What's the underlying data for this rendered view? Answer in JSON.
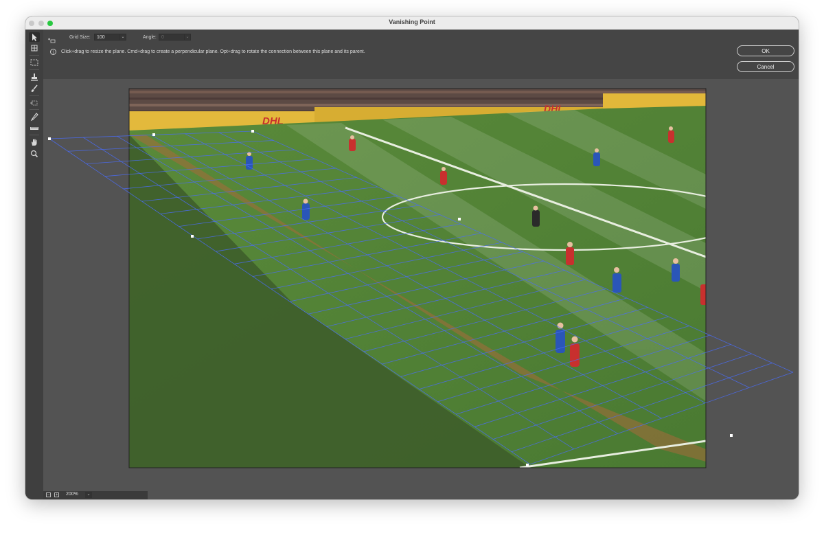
{
  "window": {
    "title": "Vanishing Point"
  },
  "options": {
    "grid_size_label": "Grid Size:",
    "grid_size_value": "100",
    "angle_label": "Angle:",
    "angle_value": "0",
    "info_text": "Click+drag to resize the plane. Cmd+drag to create a perpendicular plane. Opt+drag to rotate the connection between this plane and its parent."
  },
  "buttons": {
    "ok": "OK",
    "cancel": "Cancel"
  },
  "zoom": {
    "value": "200%",
    "minus": "−",
    "plus": "+"
  },
  "banner": {
    "ad_text_left": "DHL",
    "ad_text_right": "DHL"
  },
  "colors": {
    "accent_window_max": "#28c840",
    "grid_line": "#4a6cf7",
    "pitch": "#4e7a33",
    "ad_board": "#e3b93c",
    "team_red": "#c8302e",
    "team_blue": "#2a56b8"
  },
  "icons": {
    "tools": [
      "select-icon",
      "create-plane-icon",
      "marquee-icon",
      "stamp-icon",
      "brush-icon",
      "transform-icon",
      "eyedropper-icon",
      "measure-icon",
      "hand-icon",
      "zoom-icon"
    ]
  }
}
